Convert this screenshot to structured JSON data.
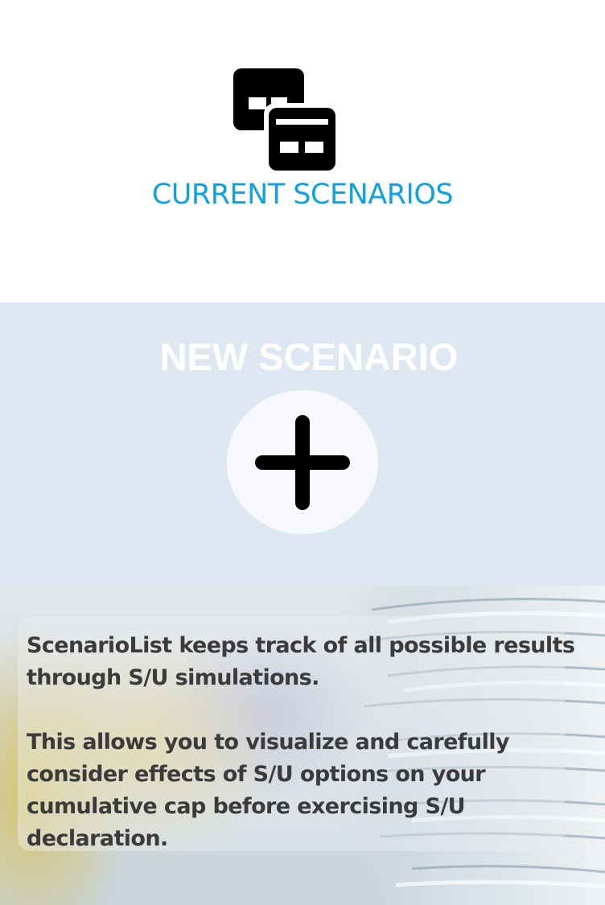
{
  "current": {
    "icon": "window-stack-icon",
    "title": "CURRENT SCENARIOS",
    "title_color": "#10a2e0"
  },
  "new_scenario": {
    "title": "NEW SCENARIO",
    "button_icon": "plus-icon",
    "background": "#dee8f3"
  },
  "info": {
    "paragraph_1": "ScenarioList keeps track of all possible results through S/U simulations.",
    "paragraph_2": "This allows you to visualize and carefully consider effects of S/U options on your cumulative cap before exercising S/U declaration."
  }
}
